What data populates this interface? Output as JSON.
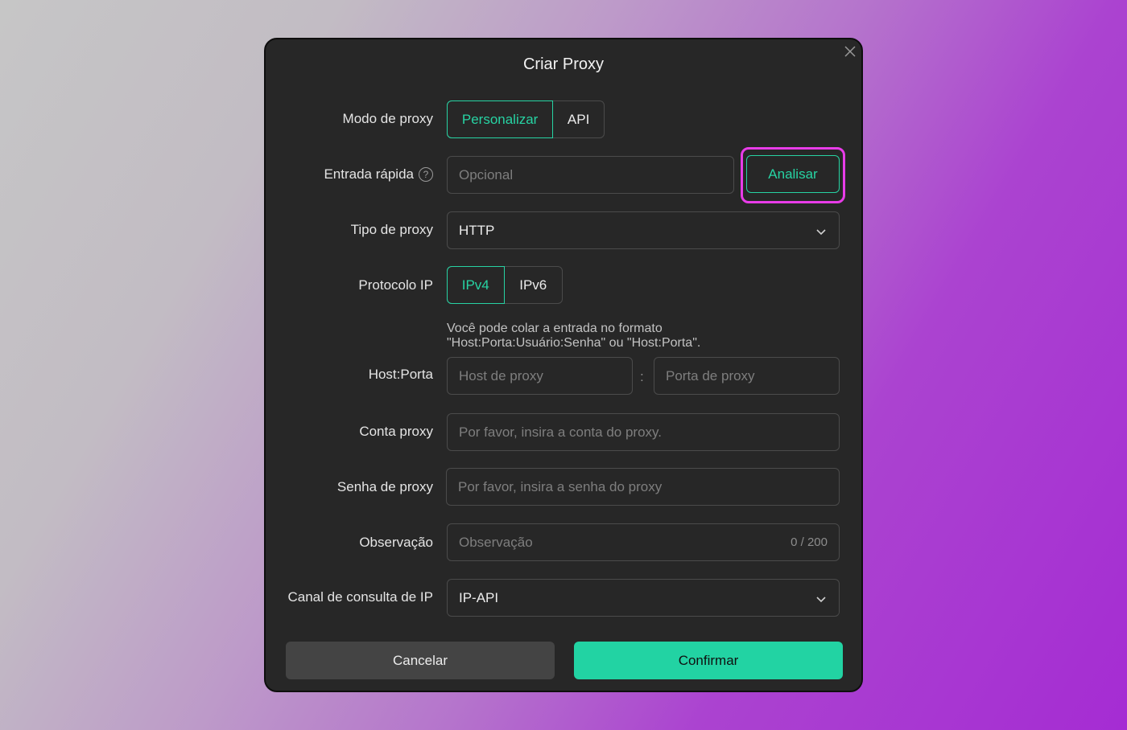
{
  "dialog": {
    "title": "Criar Proxy"
  },
  "proxy_mode": {
    "label": "Modo de proxy",
    "options": [
      "Personalizar",
      "API"
    ],
    "selected": "Personalizar"
  },
  "quick_entry": {
    "label": "Entrada rápida",
    "help_glyph": "?",
    "placeholder": "Opcional",
    "analyze_label": "Analisar"
  },
  "proxy_type": {
    "label": "Tipo de proxy",
    "value": "HTTP"
  },
  "ip_protocol": {
    "label": "Protocolo IP",
    "options": [
      "IPv4",
      "IPv6"
    ],
    "selected": "IPv4"
  },
  "hint": {
    "line1": "Você pode colar a entrada no formato",
    "line2": "\"Host:Porta:Usuário:Senha\" ou \"Host:Porta\"."
  },
  "host_port": {
    "label": "Host:Porta",
    "host_placeholder": "Host de proxy",
    "separator": ":",
    "port_placeholder": "Porta de proxy"
  },
  "account": {
    "label": "Conta proxy",
    "placeholder": "Por favor, insira a conta do proxy."
  },
  "password": {
    "label": "Senha de proxy",
    "placeholder": "Por favor, insira a senha do proxy"
  },
  "note": {
    "label": "Observação",
    "placeholder": "Observação",
    "counter": "0 / 200"
  },
  "ip_channel": {
    "label": "Canal de consulta de IP",
    "value": "IP-API"
  },
  "actions": {
    "cancel": "Cancelar",
    "confirm": "Confirmar"
  },
  "colors": {
    "accent": "#27d3a3",
    "highlight": "#e83ce8",
    "dialog_bg": "#272727"
  },
  "icons": [
    "close-icon",
    "help-icon",
    "chevron-down-icon"
  ]
}
